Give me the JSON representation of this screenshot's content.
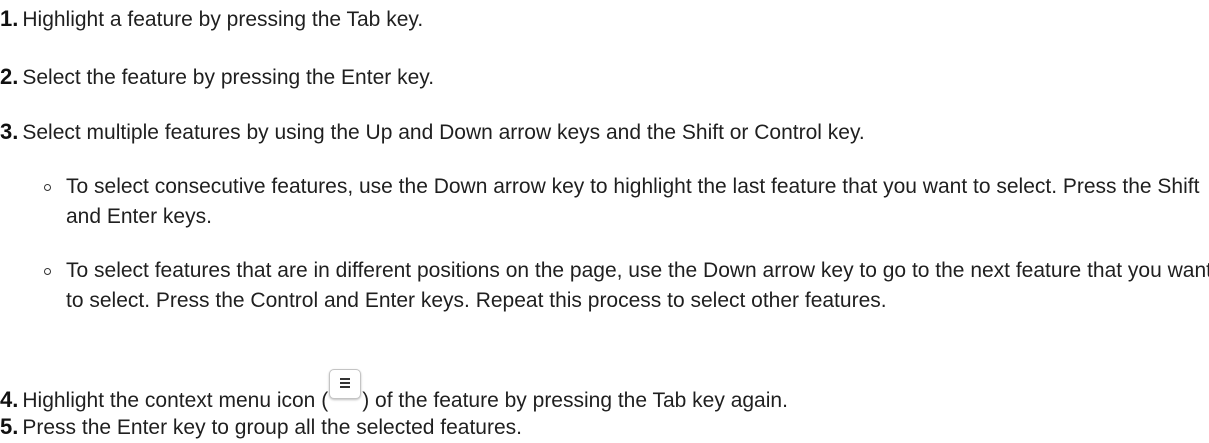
{
  "steps": [
    {
      "num": "1.",
      "text": "Highlight a feature by pressing the Tab key."
    },
    {
      "num": "2.",
      "text": "Select the feature by pressing the Enter key."
    },
    {
      "num": "3.",
      "text": "Select multiple features by using the Up and Down arrow keys and the Shift or Control key."
    },
    {
      "num": "4.",
      "text_before": "Highlight the context menu icon (",
      "icon": "hamburger-menu-icon",
      "text_after": ") of the feature by pressing the Tab key again."
    },
    {
      "num": "5.",
      "text": "Press the Enter key to group all the selected features."
    }
  ],
  "sub_items": [
    {
      "text": "To select consecutive features, use the Down arrow key to highlight the last feature that you want to select. Press the Shift and Enter keys."
    },
    {
      "text": "To select features that are in different positions on the page, use the Down arrow key to go to the next feature that you want to select. Press the Control and Enter keys. Repeat this process to select other features."
    }
  ]
}
